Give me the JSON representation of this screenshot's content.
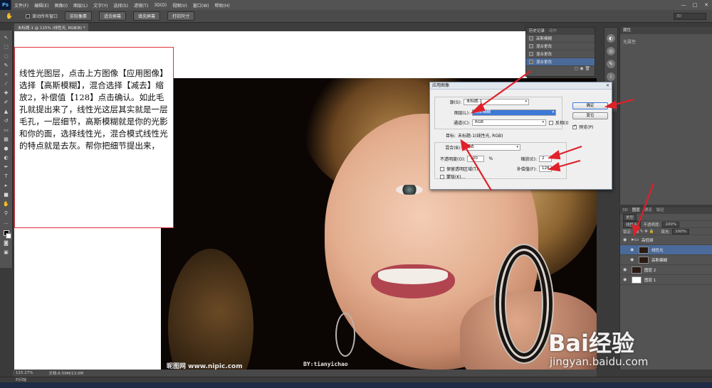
{
  "app": {
    "logo": "Ps"
  },
  "menubar": {
    "items": [
      "文件(F)",
      "编辑(E)",
      "图像(I)",
      "图层(L)",
      "文字(Y)",
      "选择(S)",
      "滤镜(T)",
      "3D(D)",
      "视图(V)",
      "窗口(W)",
      "帮助(H)"
    ],
    "window_buttons": [
      "—",
      "□",
      "✕"
    ]
  },
  "options": {
    "scroll_all": "滚动所有窗口",
    "buttons": [
      "实际像素",
      "适合屏幕",
      "填充屏幕",
      "打印尺寸"
    ],
    "workspace": "3D"
  },
  "document": {
    "tab": "未标题-1 @ 115% (线性光, RGB/8) *"
  },
  "instruction": "线性光图层，点击上方图像【应用图像】选择【高斯模糊】，混合选择【减去】缩放2，补偿值【128】点击确认。如此毛孔就提出来了，线性光这层其实就是一层毛孔，一层细节，高斯模糊就是你的光影和你的面，选择线性光，混合模式线性光的特点就是去灰。帮你把细节提出来，",
  "photo": {
    "credit_left": "昵图网 www.nipic.com",
    "credit_right": "BY:tianyichao"
  },
  "history": {
    "tabs": [
      "历史记录",
      "动作"
    ],
    "rows": [
      "高斯模糊",
      "混合更改",
      "混合更改",
      "混合更改"
    ]
  },
  "properties": {
    "title": "属性",
    "empty": "无属性"
  },
  "layers": {
    "tabs": [
      "3D",
      "图层",
      "通道",
      "路径"
    ],
    "kind": "类型",
    "blend": "线性光",
    "opacity_label": "不透明度:",
    "opacity": "100%",
    "lock_label": "锁定:",
    "fill_label": "填充:",
    "fill": "100%",
    "list": [
      {
        "name": "高低频",
        "type": "group"
      },
      {
        "name": "线性光",
        "type": "child"
      },
      {
        "name": "高斯模糊",
        "type": "child"
      },
      {
        "name": "图层 2",
        "type": "layer"
      },
      {
        "name": "图层 1",
        "type": "layer"
      }
    ]
  },
  "status": {
    "zoom": "115.27%",
    "doc": "文档:6.59M/13.0M",
    "timeline": "时间轴"
  },
  "watermark": {
    "brand": "Bai经验",
    "sub": "jingyan.baidu.com"
  },
  "dialog": {
    "title": "应用图像",
    "source_label": "源(S):",
    "source": "未标题-1",
    "layer_label": "图层(L):",
    "layer": "高斯模糊",
    "channel_label": "通道(C):",
    "channel": "RGB",
    "invert_label": "反相(I)",
    "target_label": "目标:",
    "target": "未标题-1(线性光, RGB)",
    "blend_label": "混合(B):",
    "blend": "减去",
    "opacity_label": "不透明度(O):",
    "opacity": "100",
    "percent": "%",
    "scale_label": "缩放(E):",
    "scale": "2",
    "offset_label": "补偿值(F):",
    "offset": "128",
    "preserve_label": "保留透明区域(T)",
    "mask_label": "蒙版(K)...",
    "ok": "确定",
    "reset": "复位",
    "preview_label": "预览(P)"
  }
}
